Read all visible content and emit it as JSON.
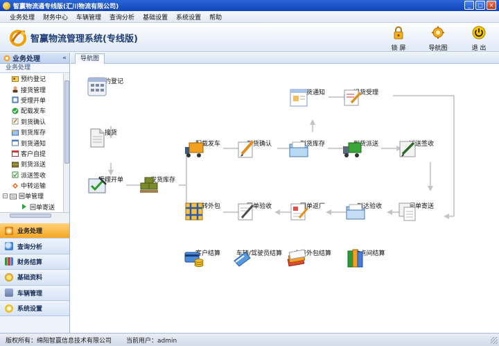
{
  "window": {
    "title": "智赢物流通专线版(汇川物流有限公司)",
    "buttons": [
      "minimize",
      "maximize",
      "close"
    ]
  },
  "menu": [
    "业务处理",
    "财务中心",
    "车辆管理",
    "查询分析",
    "基础设置",
    "系统设置",
    "帮助"
  ],
  "banner": {
    "system_title": "智赢物流管理系统(专线版)",
    "lock_label": "锁 屏",
    "navmap_label": "导航图",
    "exit_label": "退 出"
  },
  "sidebar": {
    "header": "业务处理",
    "collapse": "«",
    "sub_header": "业务处理",
    "tree": [
      {
        "label": "预约登记",
        "icon": "register-icon"
      },
      {
        "label": "接货管理",
        "icon": "pickup-icon"
      },
      {
        "label": "受理开单",
        "icon": "invoice-icon"
      },
      {
        "label": "配载发车",
        "icon": "dispatch-icon"
      },
      {
        "label": "到货确认",
        "icon": "arrival-confirm-icon"
      },
      {
        "label": "到货库存",
        "icon": "arrival-stock-icon"
      },
      {
        "label": "到货通知",
        "icon": "arrival-notice-icon"
      },
      {
        "label": "客户自提",
        "icon": "self-pickup-icon"
      },
      {
        "label": "到货派送",
        "icon": "delivery-icon"
      },
      {
        "label": "派送签收",
        "icon": "delivery-sign-icon"
      },
      {
        "label": "中转运输",
        "icon": "transfer-icon"
      }
    ],
    "tree_parent": {
      "label": "回单管理",
      "expander": "−"
    },
    "tree_child": {
      "label": "回单寄送"
    },
    "categories": [
      {
        "label": "业务处理",
        "active": true,
        "color": "#f5a623"
      },
      {
        "label": "查询分析",
        "active": false,
        "color": "#3b7dd8"
      },
      {
        "label": "财务结算",
        "active": false,
        "color": "#2a9a3a"
      },
      {
        "label": "基础资料",
        "active": false,
        "color": "#f2b01e"
      },
      {
        "label": "车辆管理",
        "active": false,
        "color": "#6a7fa8"
      },
      {
        "label": "系统设置",
        "active": false,
        "color": "#f0c020"
      }
    ]
  },
  "main": {
    "tab": "导航图",
    "nodes": {
      "yuyue": "预约登记",
      "jiehuo": "接货",
      "shouli": "受理开单",
      "fahuo_kucun": "发货库存",
      "peizai": "配载发车",
      "daohuo_queren": "到货确认",
      "daohuo_kucun": "到货库存",
      "daohuo_tongzhi": "到货通知",
      "tihuo_shouli": "提货受理",
      "daohuo_paisong": "到货派送",
      "paisong_qianshou": "派送签收",
      "zhongzhuan_waibao": "中转外包",
      "huidan_yanshou": "回单验收",
      "huidan_fanchang": "回单返厂",
      "daoda_yanshou": "到达验收",
      "huidan_jisong": "回单寄送",
      "kehu_jiesuan": "客户结算",
      "cheliang_jiesuan": "车辆/驾驶员结算",
      "zhongzhuan_jiesuan": "中转外包结算",
      "zhandian_jiesuan": "站点间结算"
    }
  },
  "status": {
    "copyright": "版权所有：绵阳智赢信息技术有限公司",
    "user_label": "当前用户：admin"
  }
}
